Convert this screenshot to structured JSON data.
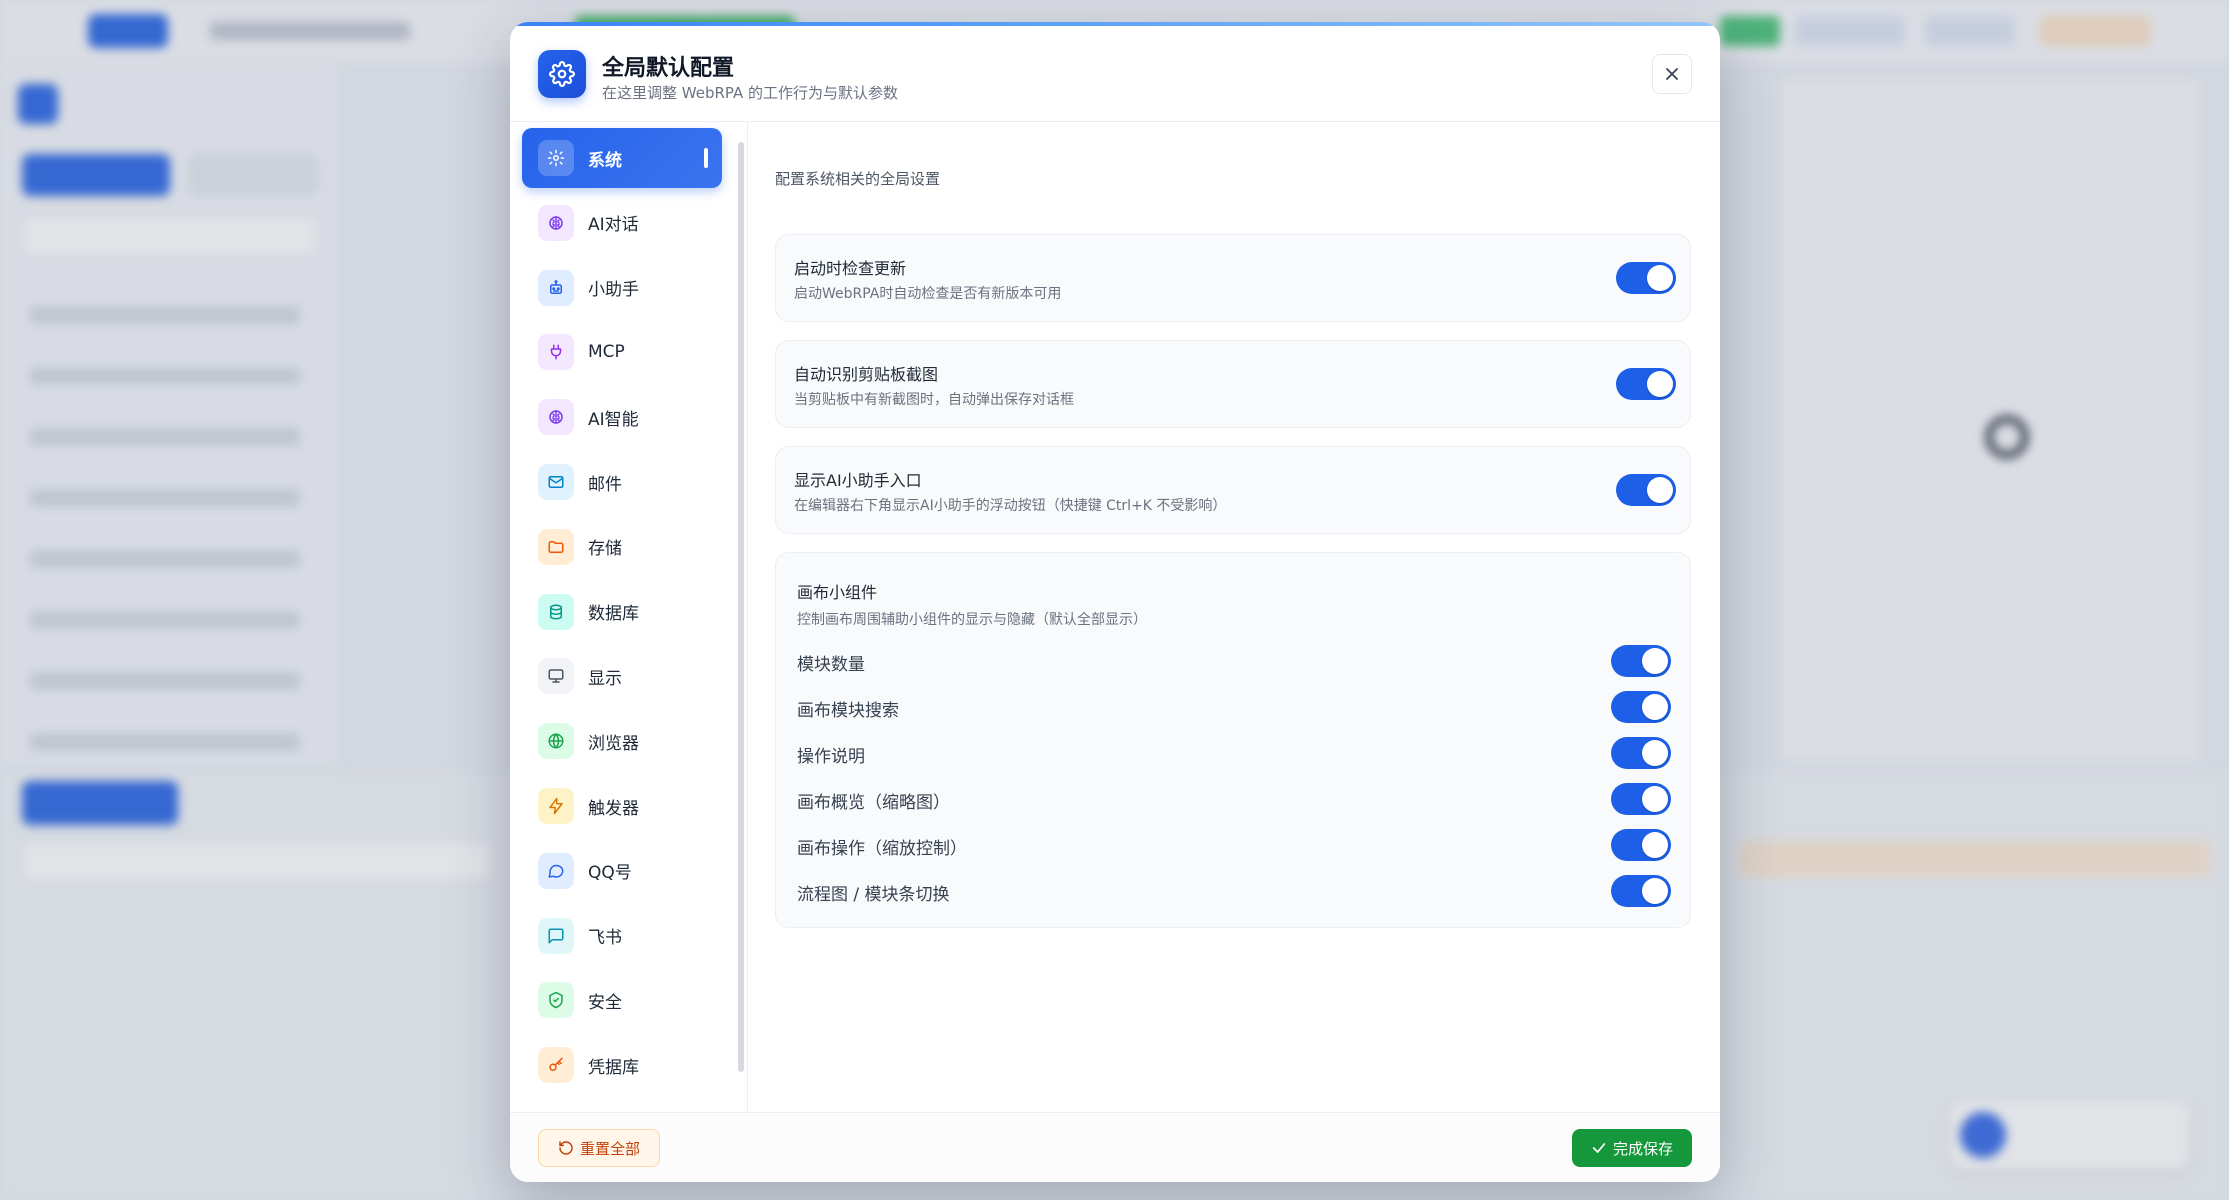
{
  "modal": {
    "title": "全局默认配置",
    "subtitle": "在这里调整 WebRPA 的工作行为与默认参数"
  },
  "nav": {
    "items": [
      {
        "label": "系统",
        "icon": "gear-icon",
        "active": true,
        "color": "#ffffff",
        "bg": "rgba(255,255,255,0.22)"
      },
      {
        "label": "AI对话",
        "icon": "brain-icon",
        "active": false,
        "color": "#7c3aed",
        "bg": "#f3e8ff"
      },
      {
        "label": "小助手",
        "icon": "robot-icon",
        "active": false,
        "color": "#2563eb",
        "bg": "#e0ecff"
      },
      {
        "label": "MCP",
        "icon": "plug-icon",
        "active": false,
        "color": "#9333ea",
        "bg": "#f3e8ff"
      },
      {
        "label": "AI智能",
        "icon": "brain-icon",
        "active": false,
        "color": "#7c3aed",
        "bg": "#f3e8ff"
      },
      {
        "label": "邮件",
        "icon": "mail-icon",
        "active": false,
        "color": "#0284c7",
        "bg": "#e0f2fe"
      },
      {
        "label": "存储",
        "icon": "folder-icon",
        "active": false,
        "color": "#ea580c",
        "bg": "#ffedd5"
      },
      {
        "label": "数据库",
        "icon": "database-icon",
        "active": false,
        "color": "#0d9488",
        "bg": "#ccfbf1"
      },
      {
        "label": "显示",
        "icon": "monitor-icon",
        "active": false,
        "color": "#4b5563",
        "bg": "#f1f3f6"
      },
      {
        "label": "浏览器",
        "icon": "globe-icon",
        "active": false,
        "color": "#16a34a",
        "bg": "#dcfce7"
      },
      {
        "label": "触发器",
        "icon": "bolt-icon",
        "active": false,
        "color": "#d97706",
        "bg": "#fef3c7"
      },
      {
        "label": "QQ号",
        "icon": "chat-bubble-icon",
        "active": false,
        "color": "#2563eb",
        "bg": "#e0ecff"
      },
      {
        "label": "飞书",
        "icon": "message-square-icon",
        "active": false,
        "color": "#0891b2",
        "bg": "#e0f7fa"
      },
      {
        "label": "安全",
        "icon": "shield-icon",
        "active": false,
        "color": "#16a34a",
        "bg": "#dcfce7"
      },
      {
        "label": "凭据库",
        "icon": "key-icon",
        "active": false,
        "color": "#ea580c",
        "bg": "#ffedd5"
      }
    ]
  },
  "content": {
    "section_desc": "配置系统相关的全局设置",
    "settings": [
      {
        "title": "启动时检查更新",
        "desc": "启动WebRPA时自动检查是否有新版本可用",
        "enabled": true
      },
      {
        "title": "自动识别剪贴板截图",
        "desc": "当剪贴板中有新截图时，自动弹出保存对话框",
        "enabled": true
      },
      {
        "title": "显示AI小助手入口",
        "desc": "在编辑器右下角显示AI小助手的浮动按钮（快捷键 Ctrl+K 不受影响）",
        "enabled": true
      }
    ],
    "widgets": {
      "title": "画布小组件",
      "desc": "控制画布周围辅助小组件的显示与隐藏（默认全部显示）",
      "items": [
        {
          "label": "模块数量",
          "enabled": true
        },
        {
          "label": "画布模块搜索",
          "enabled": true
        },
        {
          "label": "操作说明",
          "enabled": true
        },
        {
          "label": "画布概览（缩略图）",
          "enabled": true
        },
        {
          "label": "画布操作（缩放控制）",
          "enabled": true
        },
        {
          "label": "流程图 / 模块条切换",
          "enabled": true
        }
      ]
    }
  },
  "footer": {
    "reset_label": "重置全部",
    "save_label": "完成保存"
  },
  "colors": {
    "accent": "#2563eb",
    "toggle_on": "#1d5fe6",
    "save": "#15973b",
    "reset_text": "#c2410c"
  }
}
